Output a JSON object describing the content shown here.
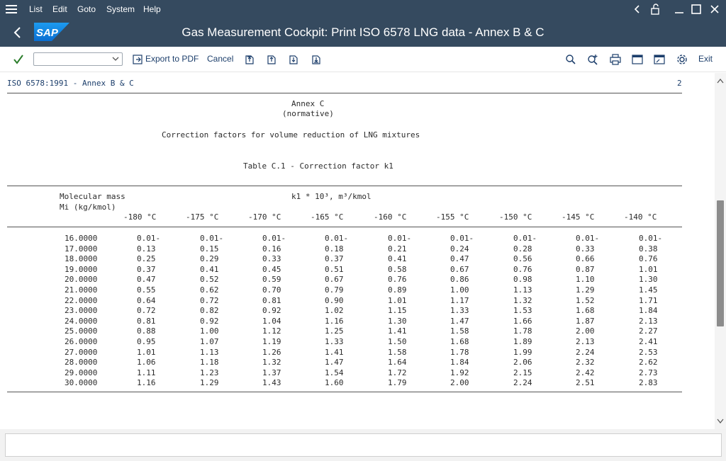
{
  "menubar": {
    "items": [
      "List",
      "Edit",
      "Goto",
      "System",
      "Help"
    ]
  },
  "titlebar": {
    "title": "Gas Measurement Cockpit: Print ISO 6578 LNG data - Annex B & C",
    "logo_text": "SAP"
  },
  "toolbar": {
    "export_pdf": "Export to PDF",
    "cancel": "Cancel",
    "exit": "Exit",
    "command_value": ""
  },
  "report": {
    "header_left": "ISO 6578:1991 - Annex B & C",
    "page_number": "2",
    "annex": "Annex C",
    "normative": "(normative)",
    "subtitle": "Correction factors for volume reduction of LNG mixtures",
    "table_title": "Table C.1 - Correction factor k1",
    "col_label_1": "Molecular mass",
    "col_label_2": "Mi (kg/kmol)",
    "unit_label": "k1 * 10³, m³/kmol",
    "temperatures": [
      "-180 °C",
      "-175 °C",
      "-170 °C",
      "-165 °C",
      "-160 °C",
      "-155 °C",
      "-150 °C",
      "-145 °C",
      "-140 °C"
    ],
    "rows": [
      {
        "m": "16.0000",
        "v": [
          "0.01-",
          "0.01-",
          "0.01-",
          "0.01-",
          "0.01-",
          "0.01-",
          "0.01-",
          "0.01-",
          "0.01-"
        ]
      },
      {
        "m": "17.0000",
        "v": [
          "0.13",
          "0.15",
          "0.16",
          "0.18",
          "0.21",
          "0.24",
          "0.28",
          "0.33",
          "0.38"
        ]
      },
      {
        "m": "18.0000",
        "v": [
          "0.25",
          "0.29",
          "0.33",
          "0.37",
          "0.41",
          "0.47",
          "0.56",
          "0.66",
          "0.76"
        ]
      },
      {
        "m": "19.0000",
        "v": [
          "0.37",
          "0.41",
          "0.45",
          "0.51",
          "0.58",
          "0.67",
          "0.76",
          "0.87",
          "1.01"
        ]
      },
      {
        "m": "20.0000",
        "v": [
          "0.47",
          "0.52",
          "0.59",
          "0.67",
          "0.76",
          "0.86",
          "0.98",
          "1.10",
          "1.30"
        ]
      },
      {
        "m": "21.0000",
        "v": [
          "0.55",
          "0.62",
          "0.70",
          "0.79",
          "0.89",
          "1.00",
          "1.13",
          "1.29",
          "1.45"
        ]
      },
      {
        "m": "22.0000",
        "v": [
          "0.64",
          "0.72",
          "0.81",
          "0.90",
          "1.01",
          "1.17",
          "1.32",
          "1.52",
          "1.71"
        ]
      },
      {
        "m": "23.0000",
        "v": [
          "0.72",
          "0.82",
          "0.92",
          "1.02",
          "1.15",
          "1.33",
          "1.53",
          "1.68",
          "1.84"
        ]
      },
      {
        "m": "24.0000",
        "v": [
          "0.81",
          "0.92",
          "1.04",
          "1.16",
          "1.30",
          "1.47",
          "1.66",
          "1.87",
          "2.13"
        ]
      },
      {
        "m": "25.0000",
        "v": [
          "0.88",
          "1.00",
          "1.12",
          "1.25",
          "1.41",
          "1.58",
          "1.78",
          "2.00",
          "2.27"
        ]
      },
      {
        "m": "26.0000",
        "v": [
          "0.95",
          "1.07",
          "1.19",
          "1.33",
          "1.50",
          "1.68",
          "1.89",
          "2.13",
          "2.41"
        ]
      },
      {
        "m": "27.0000",
        "v": [
          "1.01",
          "1.13",
          "1.26",
          "1.41",
          "1.58",
          "1.78",
          "1.99",
          "2.24",
          "2.53"
        ]
      },
      {
        "m": "28.0000",
        "v": [
          "1.06",
          "1.18",
          "1.32",
          "1.47",
          "1.64",
          "1.84",
          "2.06",
          "2.32",
          "2.62"
        ]
      },
      {
        "m": "29.0000",
        "v": [
          "1.11",
          "1.23",
          "1.37",
          "1.54",
          "1.72",
          "1.92",
          "2.15",
          "2.42",
          "2.73"
        ]
      },
      {
        "m": "30.0000",
        "v": [
          "1.16",
          "1.29",
          "1.43",
          "1.60",
          "1.79",
          "2.00",
          "2.24",
          "2.51",
          "2.83"
        ]
      }
    ]
  },
  "statusbar": {
    "message": ""
  },
  "colors": {
    "shell": "#354a5f",
    "accent": "#0a6ed1",
    "ok_green": "#2b7d2b"
  }
}
